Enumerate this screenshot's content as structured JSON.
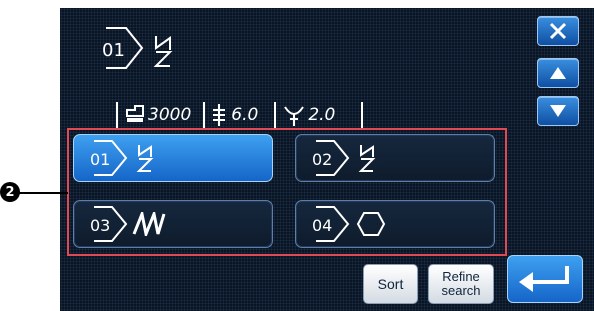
{
  "header": {
    "pattern_number": "01",
    "pattern_shape": "zigzag-bartack"
  },
  "info": {
    "speed": "3000",
    "stitch_length": "6.0",
    "thread_tension": "2.0"
  },
  "patterns": [
    {
      "number": "01",
      "shape": "zigzag-bartack",
      "selected": true
    },
    {
      "number": "02",
      "shape": "zigzag-bartack",
      "selected": false
    },
    {
      "number": "03",
      "shape": "m-zigzag",
      "selected": false
    },
    {
      "number": "04",
      "shape": "hexagon",
      "selected": false
    }
  ],
  "callout": "2",
  "buttons": {
    "sort": "Sort",
    "refine_line1": "Refine",
    "refine_line2": "search"
  },
  "icons": {
    "close": "close-icon",
    "up": "arrow-up-icon",
    "down": "arrow-down-icon",
    "enter": "enter-icon"
  },
  "colors": {
    "panel_bg": "#0a1422",
    "accent_blue": "#1e7fd8",
    "highlight_red": "#e04a55"
  }
}
